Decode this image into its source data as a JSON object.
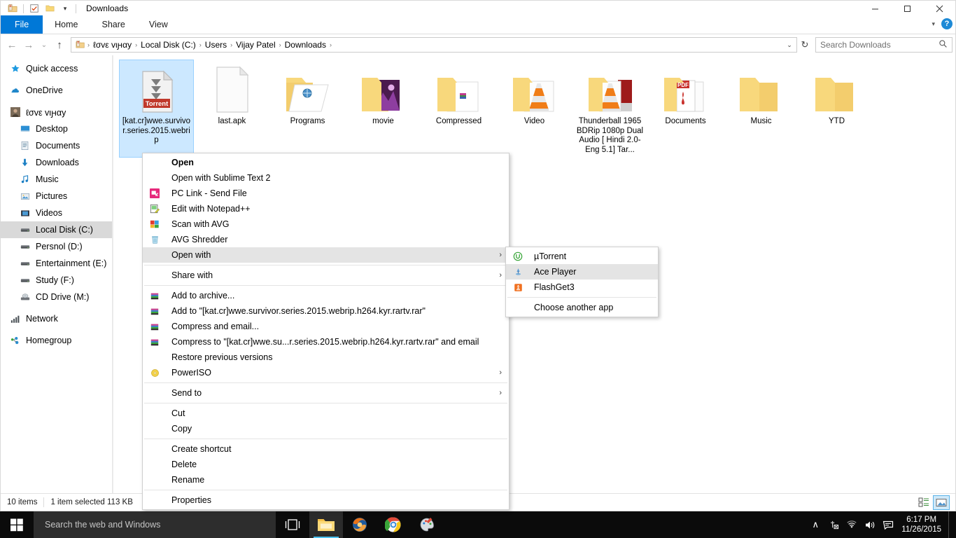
{
  "window": {
    "title": "Downloads",
    "quick_access_icons": [
      "explorer-icon",
      "properties-icon",
      "new-folder-icon",
      "customize-chevron-icon"
    ],
    "controls": {
      "minimize": "—",
      "maximize": "❐",
      "close": "✕"
    }
  },
  "ribbon": {
    "tabs": [
      {
        "label": "File",
        "active_blue": true
      },
      {
        "label": "Home",
        "active_blue": false
      },
      {
        "label": "Share",
        "active_blue": false
      },
      {
        "label": "View",
        "active_blue": false
      }
    ],
    "collapse_icon": "chevron-down-icon",
    "help_label": "?"
  },
  "address": {
    "back_icon": "←",
    "forward_icon": "→",
    "recent_icon": "⌄",
    "up_icon": "↑",
    "breadcrumbs": [
      "ℓσvε vιԩαy",
      "Local Disk (C:)",
      "Users",
      "Vijay Patel",
      "Downloads"
    ],
    "separator": "›",
    "dropdown_icon": "⌄",
    "refresh_icon": "↻"
  },
  "search": {
    "placeholder": "Search Downloads",
    "value": "",
    "icon": "search-icon"
  },
  "sidebar": {
    "items": [
      {
        "label": "Quick access",
        "icon": "star-icon",
        "indent": false,
        "selected": false,
        "gap_before": false
      },
      {
        "label": "OneDrive",
        "icon": "cloud-icon",
        "indent": false,
        "selected": false,
        "gap_before": true
      },
      {
        "label": "ℓσvε vιԩαy",
        "icon": "user-avatar-icon",
        "indent": false,
        "selected": false,
        "gap_before": true
      },
      {
        "label": "Desktop",
        "icon": "desktop-icon",
        "indent": true,
        "selected": false,
        "gap_before": false
      },
      {
        "label": "Documents",
        "icon": "documents-icon",
        "indent": true,
        "selected": false,
        "gap_before": false
      },
      {
        "label": "Downloads",
        "icon": "downloads-icon",
        "indent": true,
        "selected": false,
        "gap_before": false
      },
      {
        "label": "Music",
        "icon": "music-icon",
        "indent": true,
        "selected": false,
        "gap_before": false
      },
      {
        "label": "Pictures",
        "icon": "pictures-icon",
        "indent": true,
        "selected": false,
        "gap_before": false
      },
      {
        "label": "Videos",
        "icon": "videos-icon",
        "indent": true,
        "selected": false,
        "gap_before": false
      },
      {
        "label": "Local Disk (C:)",
        "icon": "drive-icon",
        "indent": true,
        "selected": true,
        "gap_before": false
      },
      {
        "label": "Persnol (D:)",
        "icon": "drive-icon",
        "indent": true,
        "selected": false,
        "gap_before": false
      },
      {
        "label": "Entertainment (E:)",
        "icon": "drive-icon",
        "indent": true,
        "selected": false,
        "gap_before": false
      },
      {
        "label": "Study (F:)",
        "icon": "drive-icon",
        "indent": true,
        "selected": false,
        "gap_before": false
      },
      {
        "label": "CD Drive (M:)",
        "icon": "cd-drive-icon",
        "indent": true,
        "selected": false,
        "gap_before": false
      },
      {
        "label": "Network",
        "icon": "network-icon",
        "indent": false,
        "selected": false,
        "gap_before": true
      },
      {
        "label": "Homegroup",
        "icon": "homegroup-icon",
        "indent": false,
        "selected": false,
        "gap_before": true
      }
    ]
  },
  "files": [
    {
      "name": "[kat.cr]wwe.survivor.series.2015.webrip",
      "icon": "torrent-file-icon",
      "selected": true,
      "badge": "Torrent"
    },
    {
      "name": "last.apk",
      "icon": "blank-file-icon",
      "selected": false
    },
    {
      "name": "Programs",
      "icon": "folder-programs-icon",
      "selected": false
    },
    {
      "name": "movie",
      "icon": "folder-movie-icon",
      "selected": false
    },
    {
      "name": "Compressed",
      "icon": "folder-compressed-icon",
      "selected": false
    },
    {
      "name": "Video",
      "icon": "folder-vlc-icon",
      "selected": false
    },
    {
      "name": "Thunderball 1965 BDRip 1080p Dual Audio [ Hindi 2.0- Eng 5.1] Tar...",
      "icon": "folder-vlc-red-icon",
      "selected": false
    },
    {
      "name": "Documents",
      "icon": "folder-pdf-icon",
      "selected": false
    },
    {
      "name": "Music",
      "icon": "folder-empty-icon",
      "selected": false
    },
    {
      "name": "YTD",
      "icon": "folder-empty-icon",
      "selected": false
    }
  ],
  "context_menu": {
    "items": [
      {
        "label": "Open",
        "bold": true,
        "icon": null,
        "arrow": false,
        "highlight": false,
        "sep_after": false
      },
      {
        "label": "Open with Sublime Text 2",
        "bold": false,
        "icon": null,
        "arrow": false,
        "highlight": false,
        "sep_after": false
      },
      {
        "label": "PC Link - Send File",
        "bold": false,
        "icon": "pclink-icon",
        "arrow": false,
        "highlight": false,
        "sep_after": false
      },
      {
        "label": "Edit with Notepad++",
        "bold": false,
        "icon": "notepadpp-icon",
        "arrow": false,
        "highlight": false,
        "sep_after": false
      },
      {
        "label": "Scan with AVG",
        "bold": false,
        "icon": "avg-icon",
        "arrow": false,
        "highlight": false,
        "sep_after": false
      },
      {
        "label": "AVG Shredder",
        "bold": false,
        "icon": "shredder-icon",
        "arrow": false,
        "highlight": false,
        "sep_after": false
      },
      {
        "label": "Open with",
        "bold": false,
        "icon": null,
        "arrow": true,
        "highlight": true,
        "sep_after": true
      },
      {
        "label": "Share with",
        "bold": false,
        "icon": null,
        "arrow": true,
        "highlight": false,
        "sep_after": true
      },
      {
        "label": "Add to archive...",
        "bold": false,
        "icon": "winrar-icon",
        "arrow": false,
        "highlight": false,
        "sep_after": false
      },
      {
        "label": "Add to \"[kat.cr]wwe.survivor.series.2015.webrip.h264.kyr.rartv.rar\"",
        "bold": false,
        "icon": "winrar-icon",
        "arrow": false,
        "highlight": false,
        "sep_after": false
      },
      {
        "label": "Compress and email...",
        "bold": false,
        "icon": "winrar-icon",
        "arrow": false,
        "highlight": false,
        "sep_after": false
      },
      {
        "label": "Compress to \"[kat.cr]wwe.su...r.series.2015.webrip.h264.kyr.rartv.rar\" and email",
        "bold": false,
        "icon": "winrar-icon",
        "arrow": false,
        "highlight": false,
        "sep_after": false
      },
      {
        "label": "Restore previous versions",
        "bold": false,
        "icon": null,
        "arrow": false,
        "highlight": false,
        "sep_after": false
      },
      {
        "label": "PowerISO",
        "bold": false,
        "icon": "poweriso-icon",
        "arrow": true,
        "highlight": false,
        "sep_after": true
      },
      {
        "label": "Send to",
        "bold": false,
        "icon": null,
        "arrow": true,
        "highlight": false,
        "sep_after": true
      },
      {
        "label": "Cut",
        "bold": false,
        "icon": null,
        "arrow": false,
        "highlight": false,
        "sep_after": false
      },
      {
        "label": "Copy",
        "bold": false,
        "icon": null,
        "arrow": false,
        "highlight": false,
        "sep_after": true
      },
      {
        "label": "Create shortcut",
        "bold": false,
        "icon": null,
        "arrow": false,
        "highlight": false,
        "sep_after": false
      },
      {
        "label": "Delete",
        "bold": false,
        "icon": null,
        "arrow": false,
        "highlight": false,
        "sep_after": false
      },
      {
        "label": "Rename",
        "bold": false,
        "icon": null,
        "arrow": false,
        "highlight": false,
        "sep_after": true
      },
      {
        "label": "Properties",
        "bold": false,
        "icon": null,
        "arrow": false,
        "highlight": false,
        "sep_after": false
      }
    ]
  },
  "submenu_open_with": {
    "items": [
      {
        "label": "µTorrent",
        "icon": "utorrent-icon",
        "highlight": false,
        "sep_after": false
      },
      {
        "label": "Ace Player",
        "icon": "aceplayer-icon",
        "highlight": true,
        "sep_after": false
      },
      {
        "label": "FlashGet3",
        "icon": "flashget-icon",
        "highlight": false,
        "sep_after": true
      },
      {
        "label": "Choose another app",
        "icon": null,
        "highlight": false,
        "sep_after": false
      }
    ]
  },
  "statusbar": {
    "item_count": "10 items",
    "selection": "1 item selected  113 KB",
    "view_details_icon": "details-view-icon",
    "view_large_icons_icon": "large-icons-view-icon"
  },
  "taskbar": {
    "start_icon": "windows-start-icon",
    "search_placeholder": "Search the web and Windows",
    "search_value": "",
    "taskview_icon": "task-view-icon",
    "apps": [
      {
        "name": "file-explorer",
        "icon": "explorer-taskbar-icon",
        "active": true
      },
      {
        "name": "firefox",
        "icon": "firefox-icon",
        "active": true
      },
      {
        "name": "chrome",
        "icon": "chrome-icon",
        "active": true
      },
      {
        "name": "paint",
        "icon": "paint-icon",
        "active": true
      }
    ],
    "tray": {
      "overflow_icon": "∧",
      "icons": [
        "usb-eject-icon",
        "wifi-icon",
        "volume-icon",
        "action-center-icon"
      ],
      "time": "6:17 PM",
      "date": "11/26/2015"
    }
  },
  "colors": {
    "accent_blue": "#0078d7",
    "selection_blue": "#cce8ff",
    "folder_yellow": "#f8d775",
    "taskbar_black": "#0b0b0b"
  }
}
